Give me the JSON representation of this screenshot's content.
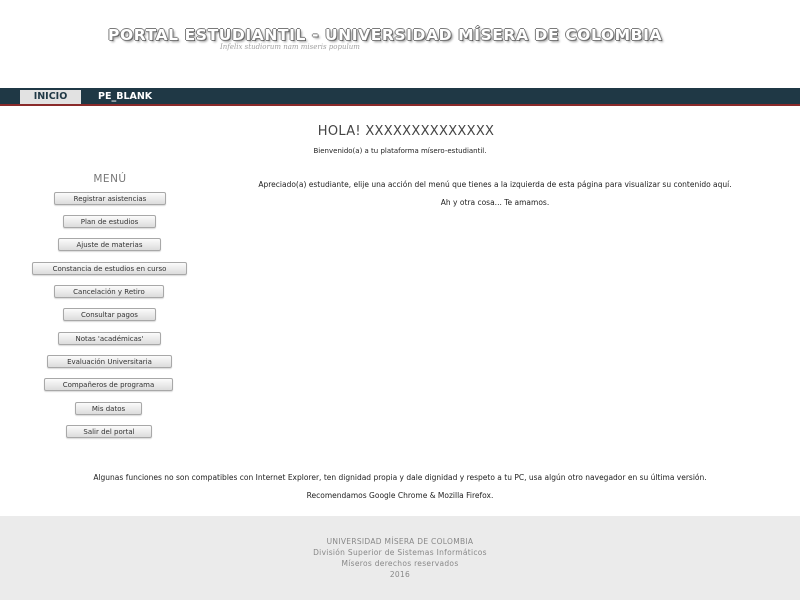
{
  "header": {
    "title": "PORTAL ESTUDIANTIL - UNIVERSIDAD MÍSERA DE COLOMBIA",
    "motto": "Infelix studiorum nam miseris populum"
  },
  "nav": {
    "tabs": [
      {
        "label": "INICIO",
        "active": true
      },
      {
        "label": "PE_BLANK",
        "active": false
      }
    ]
  },
  "main": {
    "greeting": "HOLA! XXXXXXXXXXXXXX",
    "welcome": "Bienvenido(a) a tu plataforma mísero-estudiantil.",
    "intro": "Apreciado(a) estudiante, elije una acción del menú que tienes a la izquierda de esta página para visualizar su contenido aquí.",
    "love": "Ah y otra cosa... Te amamos.",
    "compat_note": "Algunas funciones no son compatibles con Internet Explorer, ten dignidad propia y dale dignidad y respeto a tu PC, usa algún otro navegador en su última versión.",
    "recommend": "Recomendamos Google Chrome & Mozilla Firefox."
  },
  "menu": {
    "title": "MENÚ",
    "items": [
      "Registrar asistencias",
      "Plan de estudios",
      "Ajuste de materias",
      "Constancia de estudios en curso",
      "Cancelación y Retiro",
      "Consultar pagos",
      "Notas 'académicas'",
      "Evaluación Universitaria",
      "Compañeros de programa",
      "Mis datos",
      "Salir del portal"
    ]
  },
  "footer": {
    "lines": [
      "UNIVERSIDAD MÍSERA DE COLOMBIA",
      "División Superior de Sistemas Informáticos",
      "Míseros derechos reservados",
      "2016"
    ]
  }
}
